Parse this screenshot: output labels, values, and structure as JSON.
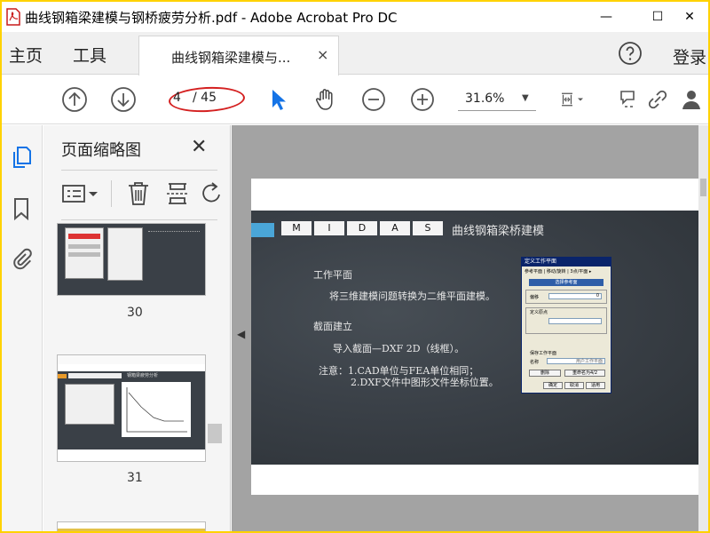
{
  "window": {
    "title": "曲线钢箱梁建模与钢桥疲劳分析.pdf - Adobe Acrobat Pro DC",
    "minimize_glyph": "—",
    "maximize_glyph": "☐",
    "close_glyph": "✕"
  },
  "tabs": {
    "home": "主页",
    "tools": "工具",
    "document_tab": "曲线钢箱梁建模与...",
    "close_glyph": "×",
    "login": "登录"
  },
  "toolbar": {
    "current_page": "4",
    "total_pages": "/ 45",
    "zoom": "31.6%",
    "highlight_color": "#d42020",
    "icons": [
      "prev-page-icon",
      "next-page-icon",
      "select-pointer-icon",
      "hand-icon",
      "zoom-out-icon",
      "zoom-in-icon",
      "fit-page-icon",
      "comment-icon",
      "link-icon",
      "share-icon"
    ]
  },
  "rail": {
    "icons": [
      "page-thumbnails-icon",
      "bookmark-icon",
      "attachment-icon"
    ]
  },
  "thumbnail_panel": {
    "title": "页面缩略图",
    "close_glyph": "✕",
    "tools": [
      "thumbnail-options-icon",
      "delete-page-icon",
      "insert-page-icon",
      "rotate-page-icon"
    ],
    "pages": [
      {
        "number": "30"
      },
      {
        "number": "31"
      }
    ],
    "thumb31_title": "钢箱梁疲劳分析"
  },
  "slide": {
    "letters": [
      "M",
      "I",
      "D",
      "A",
      "S"
    ],
    "title": "曲线钢箱梁桥建模",
    "heading1": "工作平面",
    "line1": "将三维建模问题转换为二维平面建模。",
    "heading2": "截面建立",
    "line2": "导入截面—DXF 2D（线框）。",
    "note1": "注意：1.CAD单位与FEA单位相同；",
    "note2": "2.DXF文件中图形文件坐标位置。",
    "accent_color": "#4aa6d8"
  },
  "dialog": {
    "caption": "定义工作平面",
    "tabs": "参考平面 | 移动/旋转 | 3点/平面 ▸",
    "select_button": "选择参考面",
    "offset_label": "偏移",
    "offset_value": "0",
    "custom_origin": "定义原点",
    "save_plane": "保存工作平面",
    "name_label": "名称",
    "name_value": "用户工作平面",
    "delete_btn": "删除",
    "rename_btn": "重命名为4/2",
    "ok_btn": "确定",
    "cancel_btn": "取消",
    "apply_btn": "适用"
  }
}
